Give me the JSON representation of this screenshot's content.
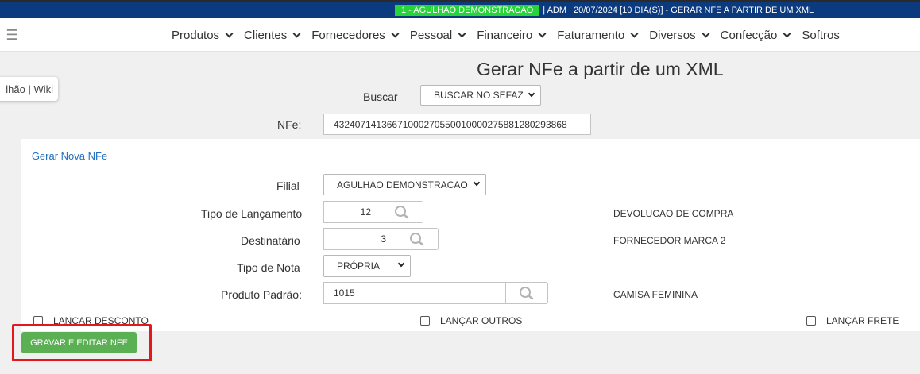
{
  "topbar": {
    "company_badge": "1 - AGULHAO DEMONSTRACAO",
    "session_info": "| ADM | 20/07/2024 [10 DIA(S)] - GERAR NFE A PARTIR DE UM XML"
  },
  "nav": {
    "menu_icon": "hamburger-icon",
    "items": [
      "Produtos",
      "Clientes",
      "Fornecedores",
      "Pessoal",
      "Financeiro",
      "Faturamento",
      "Diversos",
      "Confecção",
      "Softros"
    ]
  },
  "help_popup": "lhão | Wiki",
  "page_title": "Gerar NFe a partir de um XML",
  "search": {
    "buscar_label": "Buscar",
    "buscar_value": "BUSCAR NO SEFAZ",
    "nfe_label": "NFe:",
    "nfe_value": "43240714136671000270550010000275881280293868"
  },
  "tabs": {
    "active": "Gerar Nova NFe"
  },
  "form": {
    "filial_label": "Filial",
    "filial_value": "AGULHAO DEMONSTRACAO",
    "tipo_lanc_label": "Tipo de Lançamento",
    "tipo_lanc_value": "12",
    "tipo_lanc_desc": "DEVOLUCAO DE COMPRA",
    "destinatario_label": "Destinatário",
    "destinatario_value": "3",
    "destinatario_desc": "FORNECEDOR MARCA 2",
    "tipo_nota_label": "Tipo de Nota",
    "tipo_nota_value": "PRÓPRIA",
    "produto_label": "Produto Padrão:",
    "produto_value": "1015",
    "produto_desc": "CAMISA FEMININA"
  },
  "checkboxes": {
    "desconto": "LANÇAR DESCONTO",
    "outros": "LANÇAR OUTROS",
    "frete": "LANÇAR FRETE"
  },
  "actions": {
    "save_label": "GRAVAR E EDITAR NFE"
  },
  "colors": {
    "topbar": "#0b3a7e",
    "badge": "#27d43a",
    "button": "#5cb054",
    "highlight": "#e4171b",
    "tab_text": "#1f6fbf"
  }
}
